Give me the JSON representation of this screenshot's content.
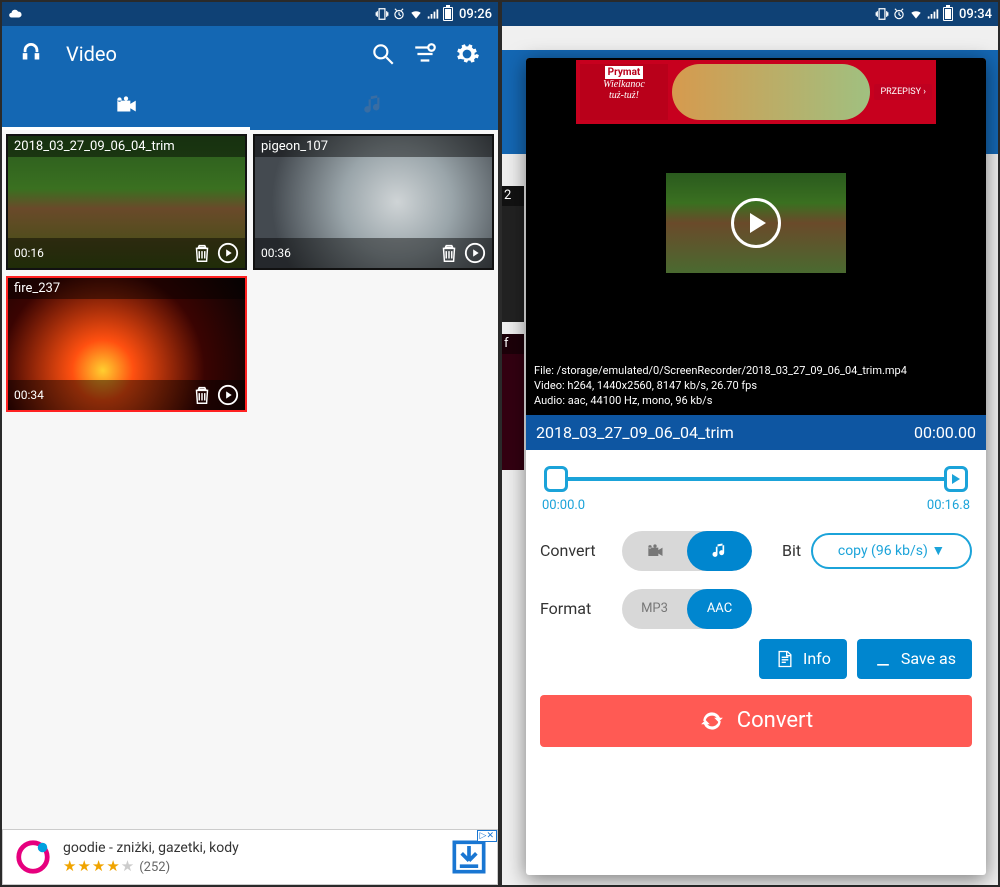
{
  "colors": {
    "primary": "#1467b3",
    "accent": "#0086cf",
    "convert": "#ff5a54",
    "trim": "#1ba3d9"
  },
  "left": {
    "status": {
      "time": "09:26"
    },
    "toolbar": {
      "title": "Video"
    },
    "tabs": {
      "active": "video"
    },
    "videos": [
      {
        "name": "2018_03_27_09_06_04_trim",
        "duration": "00:16",
        "thumb": "forest",
        "selected": false
      },
      {
        "name": "pigeon_107",
        "duration": "00:36",
        "thumb": "pigeon",
        "selected": false
      },
      {
        "name": "fire_237",
        "duration": "00:34",
        "thumb": "fire",
        "selected": true
      }
    ],
    "ad": {
      "title": "goodie - zniżki, gazetki, kody",
      "stars": 4,
      "ratings": "(252)",
      "badge": "▷✕"
    }
  },
  "right": {
    "status": {
      "time": "09:34"
    },
    "peek": {
      "card1": "2",
      "card2": "f"
    },
    "preview_ad": {
      "brand_line1": "Prymat",
      "brand_line2": "Wielkanoc",
      "brand_line3": "tuż-tuż!",
      "cta": "PRZEPISY ›"
    },
    "fileinfo": {
      "l1": "File: /storage/emulated/0/ScreenRecorder/2018_03_27_09_06_04_trim.mp4",
      "l2": "Video: h264, 1440x2560,  8147 kb/s,  26.70 fps",
      "l3": "Audio: aac,  44100 Hz,  mono, 96 kb/s"
    },
    "title": {
      "name": "2018_03_27_09_06_04_trim",
      "position": "00:00.00"
    },
    "trim": {
      "start": "00:00.0",
      "end": "00:16.8"
    },
    "convert_row": {
      "label": "Convert",
      "bit_label": "Bit",
      "bit_value": "copy (96 kb/s) ▼",
      "selected": "audio"
    },
    "format_row": {
      "label": "Format",
      "opt1": "MP3",
      "opt2": "AAC",
      "selected": "AAC"
    },
    "buttons": {
      "info": "Info",
      "save_as": "Save as",
      "convert": "Convert"
    }
  }
}
